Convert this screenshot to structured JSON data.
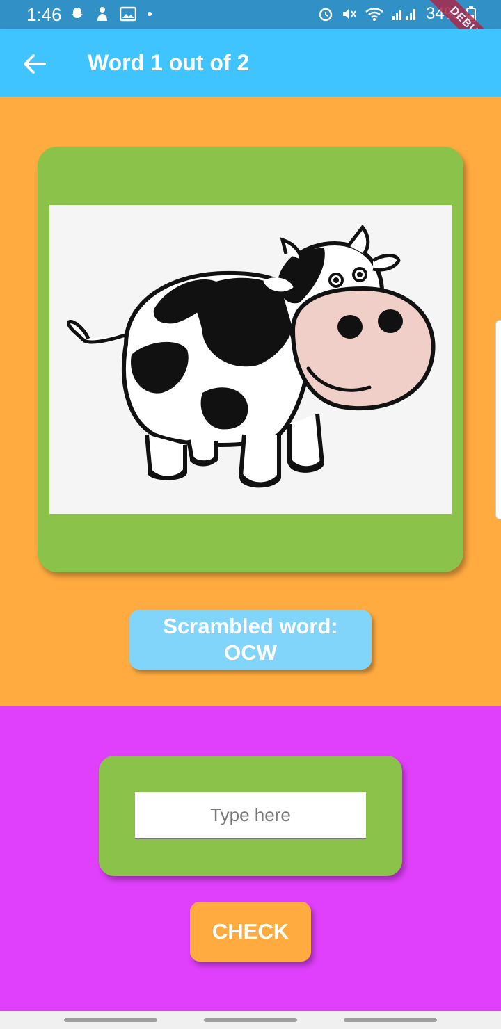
{
  "status_bar": {
    "time": "1:46",
    "battery": "34%",
    "left_icons": [
      "snapchat-icon",
      "notification-icon",
      "image-icon",
      "dot-icon"
    ],
    "right_icons": [
      "alarm-icon",
      "mute-icon",
      "wifi-icon",
      "signal-icon",
      "battery-icon"
    ]
  },
  "debug_banner": "DEBUG",
  "app_bar": {
    "back_icon": "arrow-back-icon",
    "title": "Word 1 out of 2"
  },
  "scrambled": {
    "label": "Scrambled word:",
    "word": "OCW"
  },
  "answer": {
    "placeholder": "Type here",
    "value": ""
  },
  "check_button": {
    "label": "CHECK"
  },
  "colors": {
    "status_bar": "#3191c6",
    "app_bar": "#40c4ff",
    "top_background": "#ffab40",
    "card_green": "#8bc34a",
    "scrambled_box": "#81d4fa",
    "bottom_background": "#e040fb",
    "check_button": "#ffab40"
  }
}
